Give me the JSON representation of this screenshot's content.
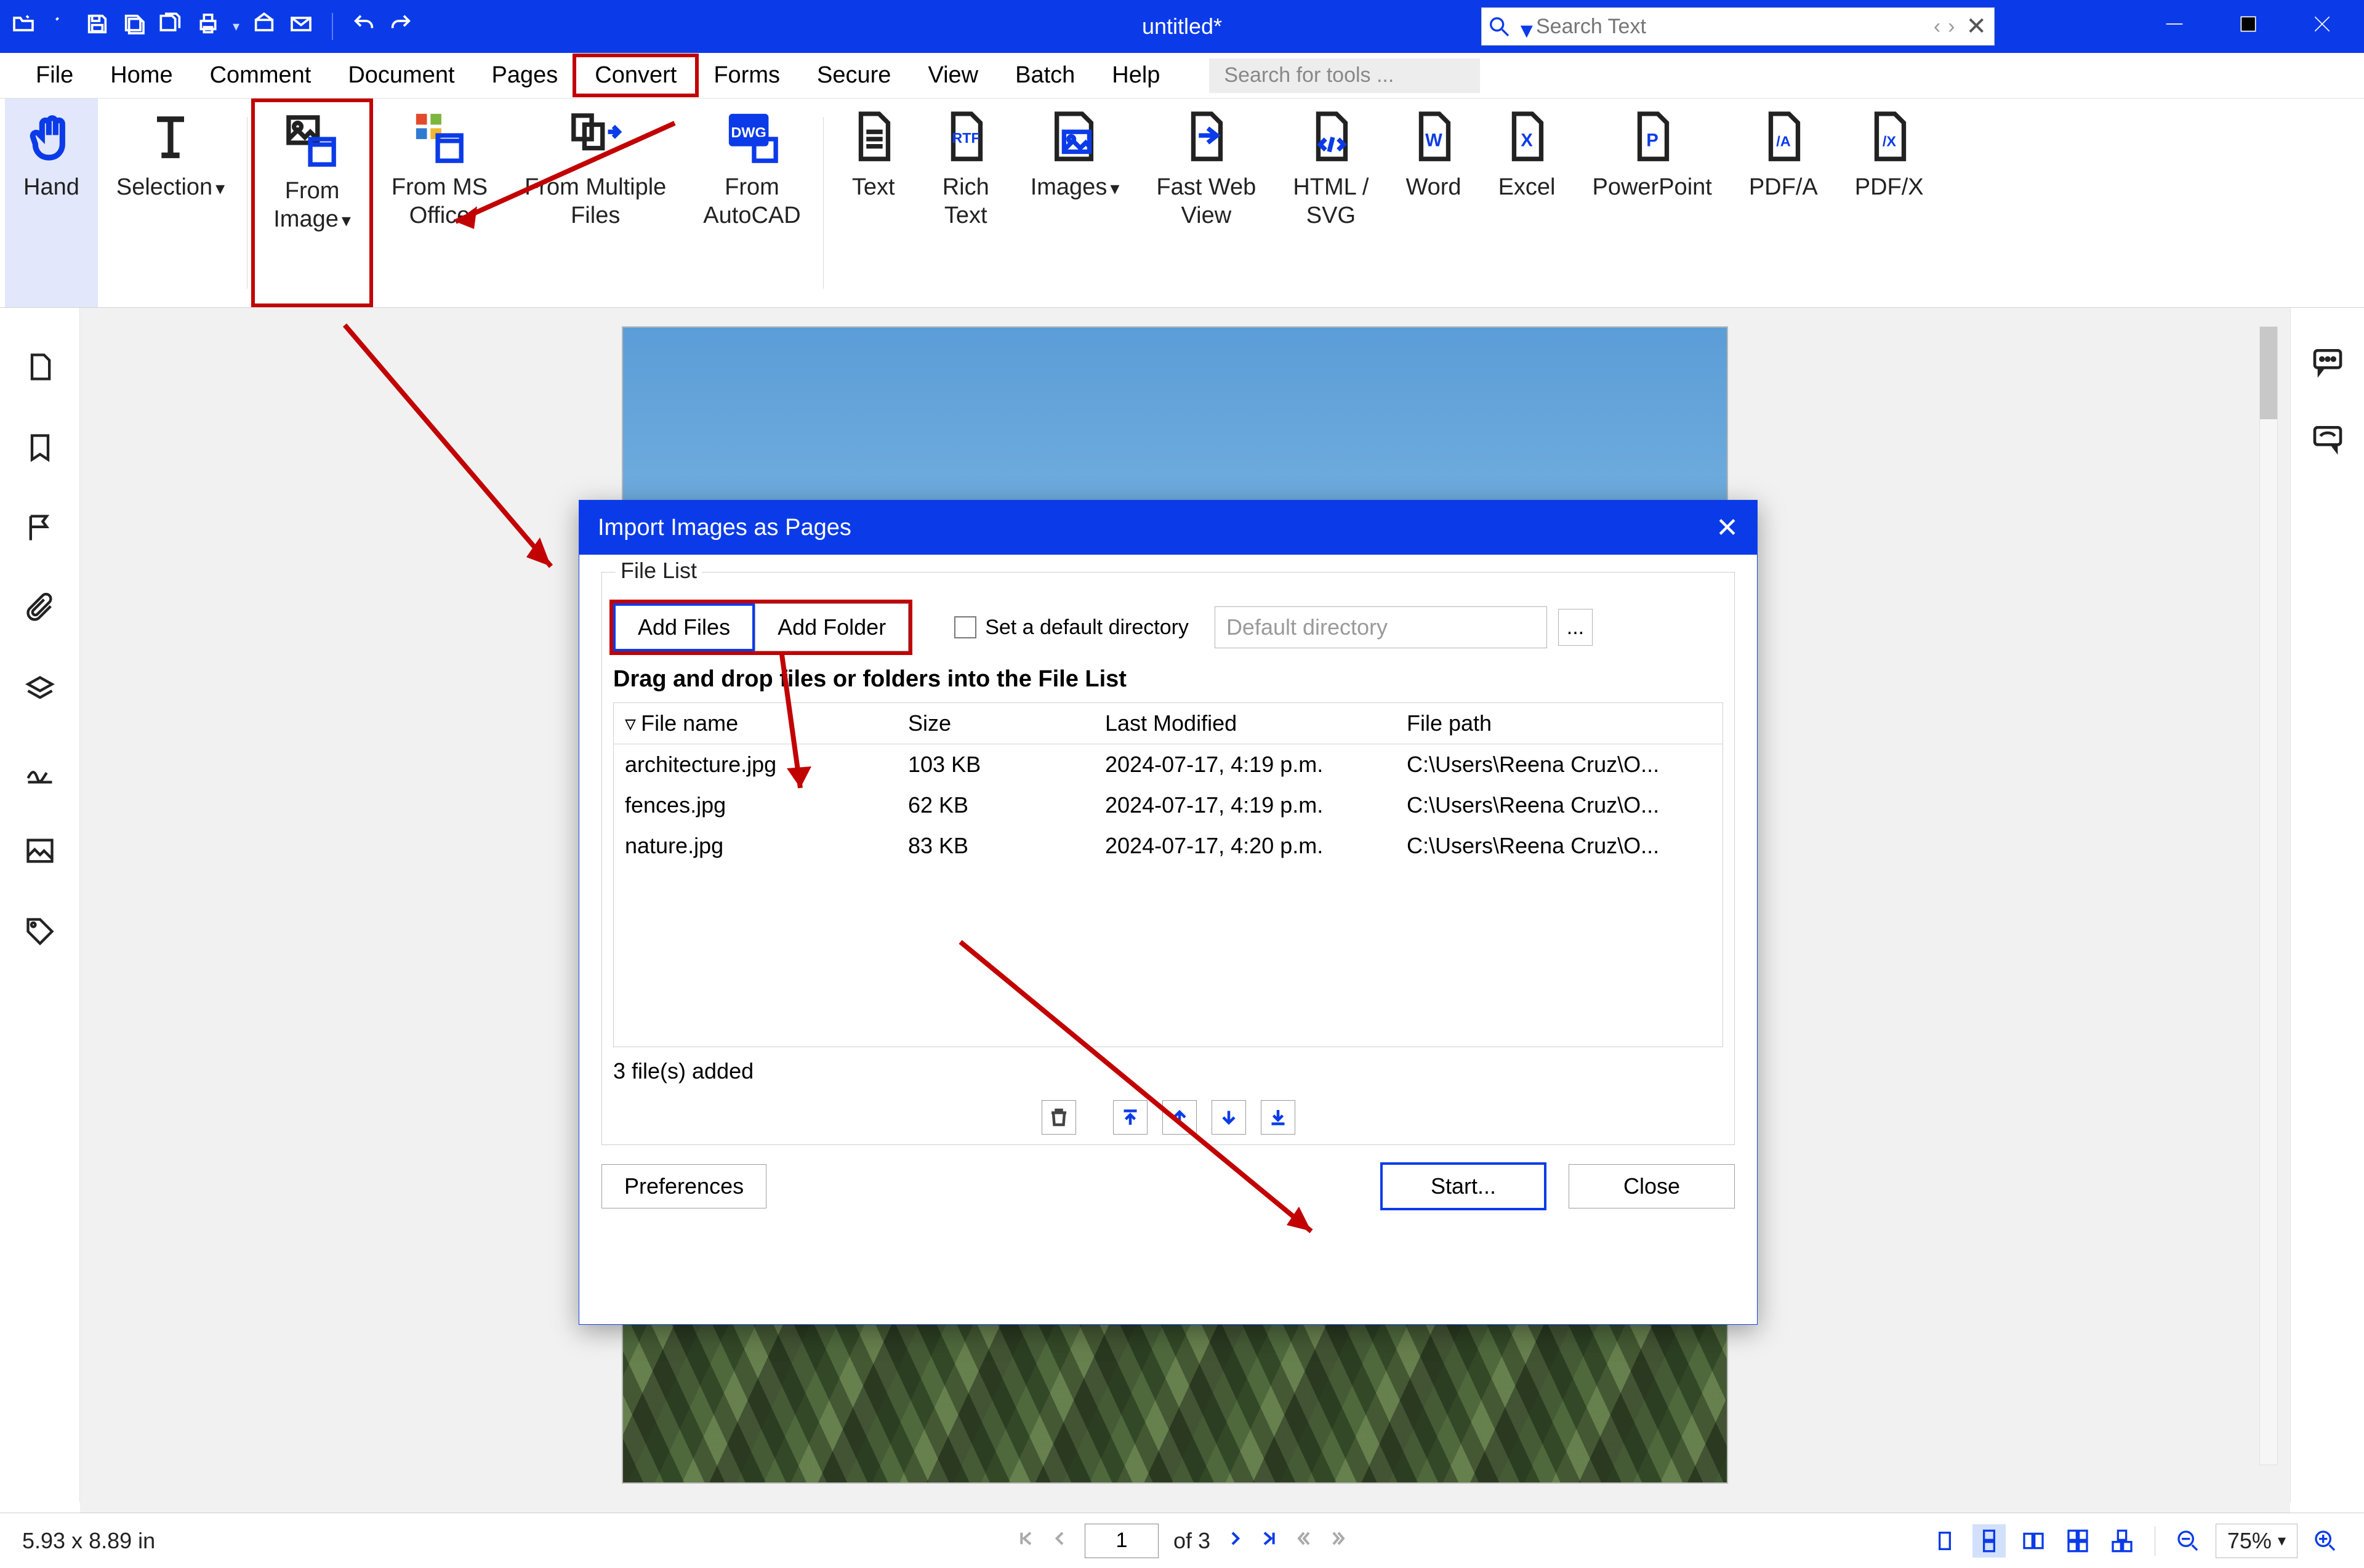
{
  "title": "untitled*",
  "search_placeholder": "Search Text",
  "tools_search_placeholder": "Search for tools ...",
  "menus": [
    "File",
    "Home",
    "Comment",
    "Document",
    "Pages",
    "Convert",
    "Forms",
    "Secure",
    "View",
    "Batch",
    "Help"
  ],
  "ribbon": {
    "hand": "Hand",
    "selection": "Selection",
    "from_image": "From\nImage",
    "from_ms_office": "From MS\nOffice",
    "from_multiple_files": "From Multiple\nFiles",
    "from_autocad": "From\nAutoCAD",
    "text": "Text",
    "rich_text": "Rich\nText",
    "images": "Images",
    "fast_web_view": "Fast Web\nView",
    "html_svg": "HTML /\nSVG",
    "word": "Word",
    "excel": "Excel",
    "powerpoint": "PowerPoint",
    "pdfa": "PDF/A",
    "pdfx": "PDF/X"
  },
  "dialog": {
    "title": "Import Images as Pages",
    "group_title": "File List",
    "add_files": "Add Files",
    "add_folder": "Add Folder",
    "set_default_dir": "Set a default directory",
    "default_dir_placeholder": "Default directory",
    "hint": "Drag and drop files or folders into the File List",
    "columns": {
      "name": "File name",
      "size": "Size",
      "modified": "Last Modified",
      "path": "File path"
    },
    "rows": [
      {
        "name": "architecture.jpg",
        "size": "103 KB",
        "modified": "2024-07-17, 4:19 p.m.",
        "path": "C:\\Users\\Reena Cruz\\O..."
      },
      {
        "name": "fences.jpg",
        "size": "62 KB",
        "modified": "2024-07-17, 4:19 p.m.",
        "path": "C:\\Users\\Reena Cruz\\O..."
      },
      {
        "name": "nature.jpg",
        "size": "83 KB",
        "modified": "2024-07-17, 4:20 p.m.",
        "path": "C:\\Users\\Reena Cruz\\O..."
      }
    ],
    "added_text": "3 file(s) added",
    "preferences": "Preferences",
    "start": "Start...",
    "close": "Close"
  },
  "statusbar": {
    "dims": "5.93 x 8.89 in",
    "page_value": "1",
    "page_total": "of 3",
    "zoom": "75%"
  }
}
